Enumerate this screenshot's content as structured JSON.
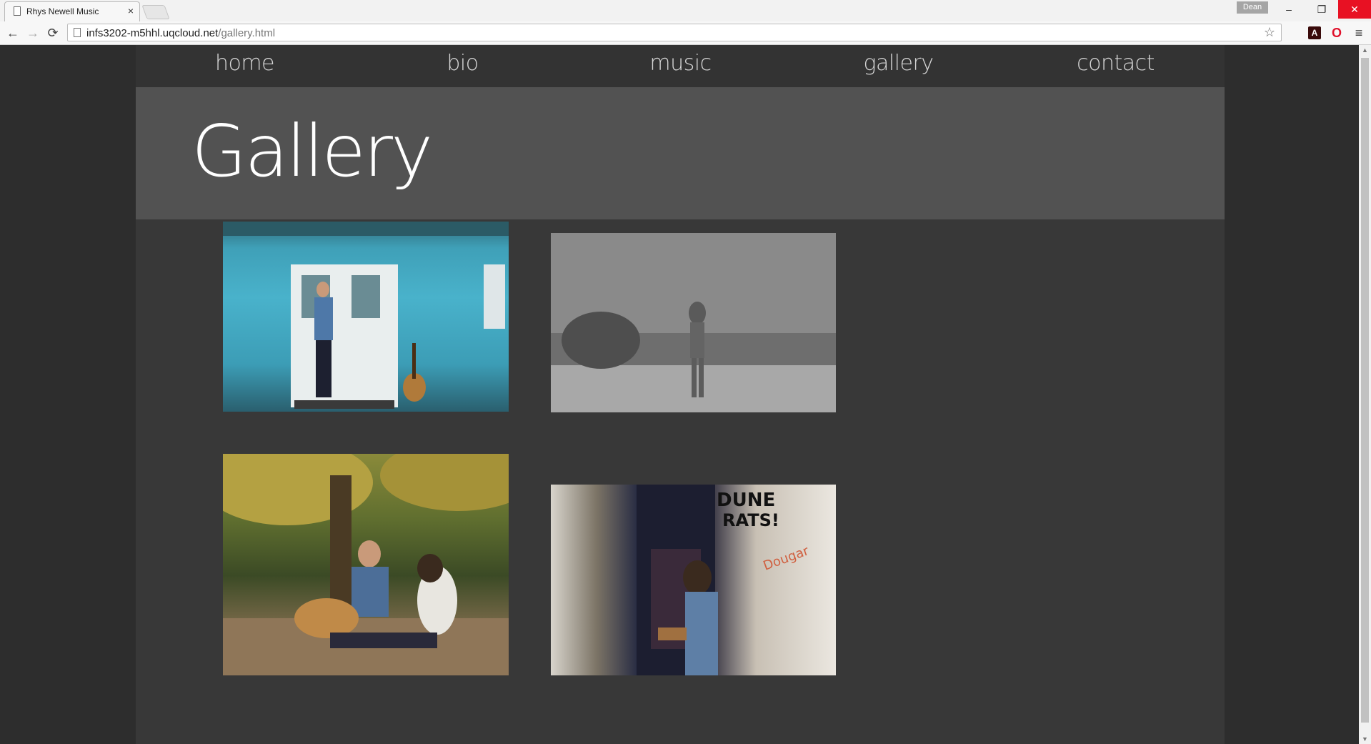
{
  "browser": {
    "tab_title": "Rhys Newell Music",
    "tab_close": "×",
    "profile_name": "Dean",
    "url_host": "infs3202-m5hhl.uqcloud.net",
    "url_path": "/gallery.html",
    "window_controls": {
      "minimize": "–",
      "maximize": "❐",
      "close": "✕"
    },
    "nav_glyphs": {
      "back": "←",
      "forward": "→",
      "reload": "⟳",
      "star": "☆",
      "menu": "≡"
    }
  },
  "site": {
    "nav": {
      "home": "home",
      "bio": "bio",
      "music": "music",
      "gallery": "gallery",
      "contact": "contact"
    },
    "page_title": "Gallery"
  },
  "gallery": {
    "photo_count": 4
  },
  "colors": {
    "page_background": "#2d2d2d",
    "content_background": "#383838",
    "nav_background": "#333333",
    "hero_background": "#525252",
    "nav_text": "#d6d6d6",
    "title_text": "#ffffff",
    "window_close": "#e81123"
  },
  "icons": [
    "page-icon",
    "back-arrow-icon",
    "forward-arrow-icon",
    "reload-icon",
    "star-icon",
    "pdf-extension-icon",
    "opera-extension-icon",
    "menu-icon"
  ]
}
